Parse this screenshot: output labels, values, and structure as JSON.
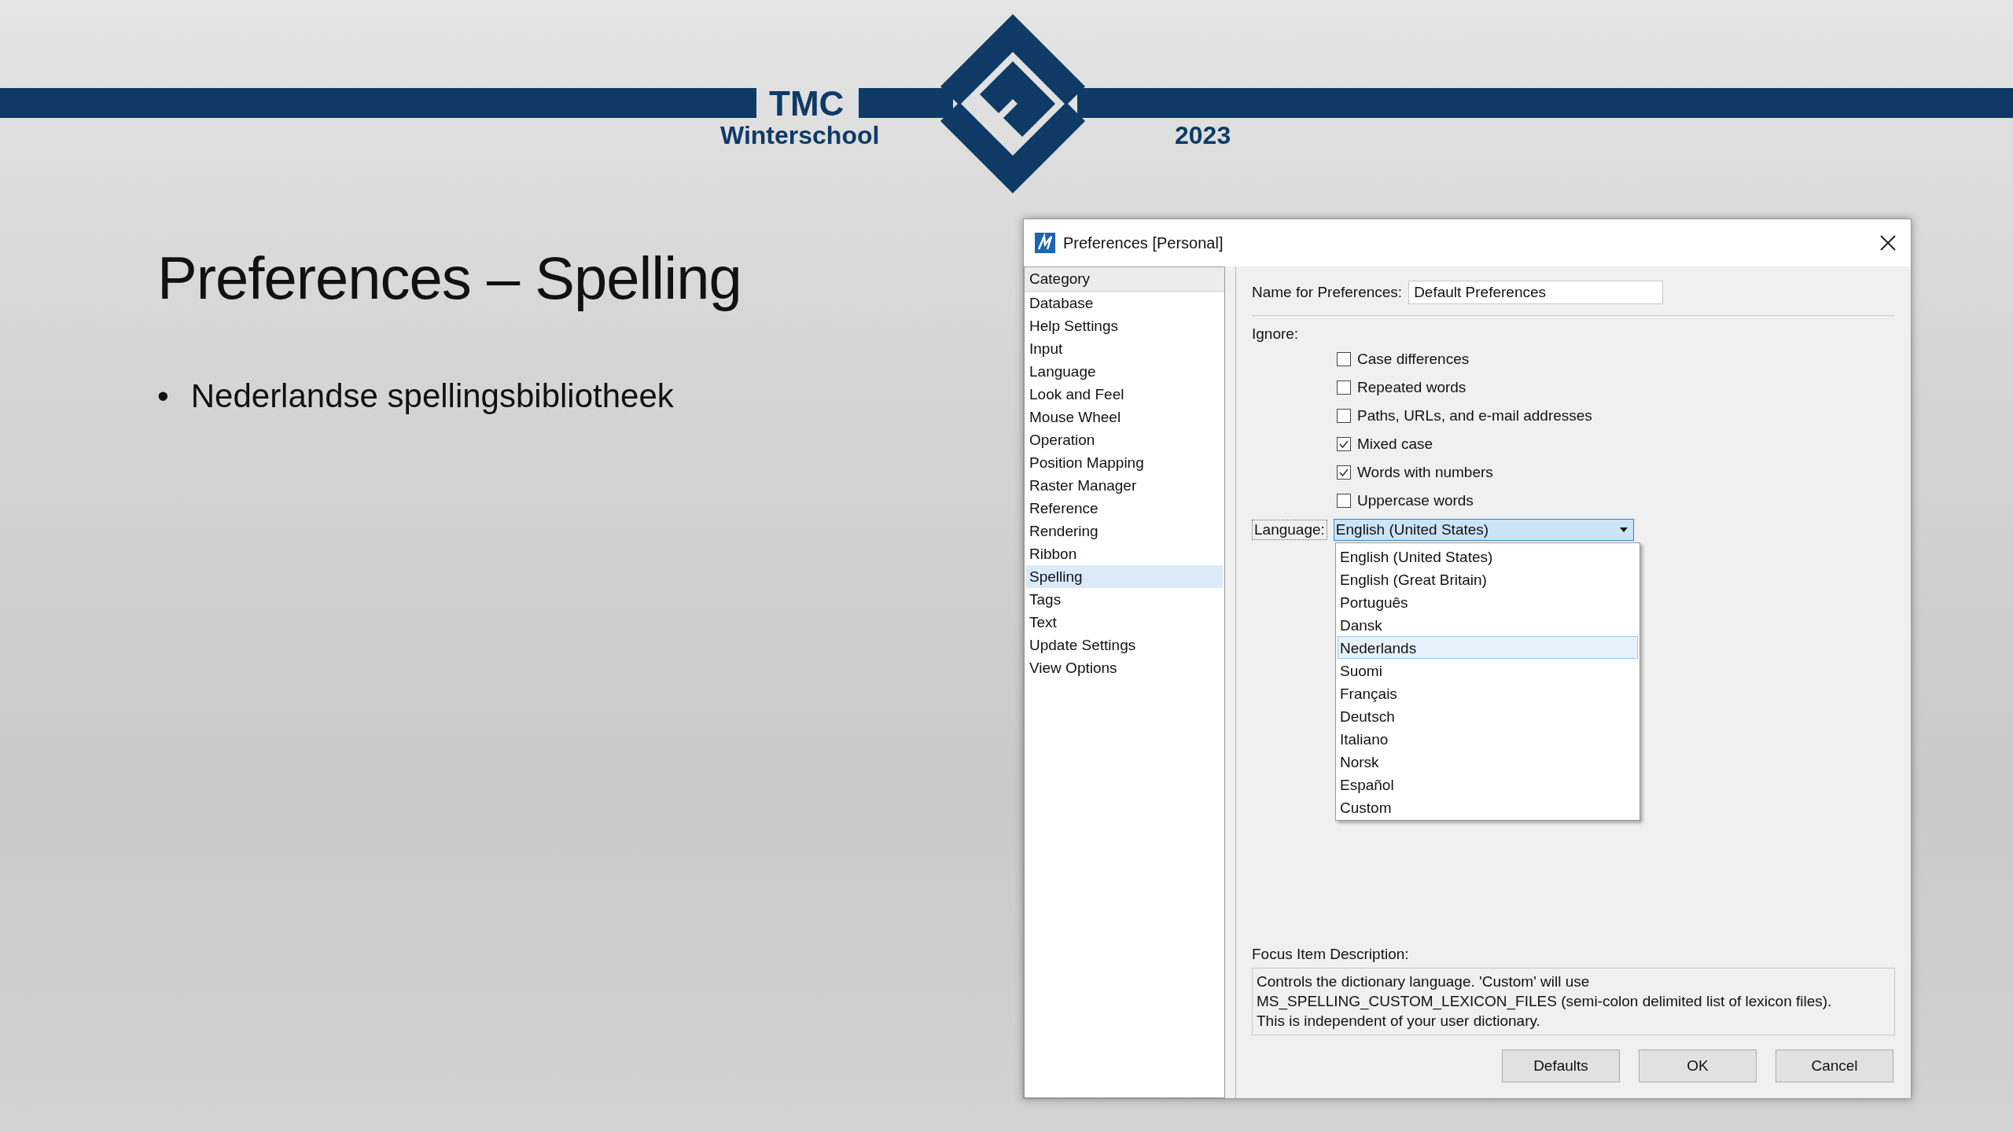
{
  "header": {
    "brand": "TMC",
    "subtitle": "Winterschool",
    "year": "2023"
  },
  "slide": {
    "title": "Preferences – Spelling",
    "bullets": [
      {
        "marker": "•",
        "text": "Nederlandse spellingsbibliotheek"
      }
    ]
  },
  "dialog": {
    "title": "Preferences [Personal]",
    "category_header": "Category",
    "categories": [
      {
        "label": "Database",
        "selected": false
      },
      {
        "label": "Help Settings",
        "selected": false
      },
      {
        "label": "Input",
        "selected": false
      },
      {
        "label": "Language",
        "selected": false
      },
      {
        "label": "Look and Feel",
        "selected": false
      },
      {
        "label": "Mouse Wheel",
        "selected": false
      },
      {
        "label": "Operation",
        "selected": false
      },
      {
        "label": "Position Mapping",
        "selected": false
      },
      {
        "label": "Raster Manager",
        "selected": false
      },
      {
        "label": "Reference",
        "selected": false
      },
      {
        "label": "Rendering",
        "selected": false
      },
      {
        "label": "Ribbon",
        "selected": false
      },
      {
        "label": "Spelling",
        "selected": true
      },
      {
        "label": "Tags",
        "selected": false
      },
      {
        "label": "Text",
        "selected": false
      },
      {
        "label": "Update Settings",
        "selected": false
      },
      {
        "label": "View Options",
        "selected": false
      }
    ],
    "name_label": "Name for Preferences:",
    "name_value": "Default Preferences",
    "ignore_label": "Ignore:",
    "options": [
      {
        "label": "Case differences",
        "checked": false
      },
      {
        "label": "Repeated words",
        "checked": false
      },
      {
        "label": "Paths, URLs, and e-mail addresses",
        "checked": false
      },
      {
        "label": "Mixed case",
        "checked": true
      },
      {
        "label": "Words with numbers",
        "checked": true
      },
      {
        "label": "Uppercase words",
        "checked": false
      }
    ],
    "language_label": "Language:",
    "language_value": "English (United States)",
    "language_expanded": true,
    "language_options": [
      {
        "label": "English (United States)",
        "selected": false
      },
      {
        "label": "English (Great Britain)",
        "selected": false
      },
      {
        "label": "Português",
        "selected": false
      },
      {
        "label": "Dansk",
        "selected": false
      },
      {
        "label": "Nederlands",
        "selected": true
      },
      {
        "label": "Suomi",
        "selected": false
      },
      {
        "label": "Français",
        "selected": false
      },
      {
        "label": "Deutsch",
        "selected": false
      },
      {
        "label": "Italiano",
        "selected": false
      },
      {
        "label": "Norsk",
        "selected": false
      },
      {
        "label": "Español",
        "selected": false
      },
      {
        "label": "Custom",
        "selected": false
      }
    ],
    "focus_label": "Focus Item Description:",
    "focus_text": "Controls the dictionary language. 'Custom' will use\nMS_SPELLING_CUSTOM_LEXICON_FILES (semi-colon delimited list of lexicon files).\nThis is independent of your user dictionary.",
    "buttons": [
      "Defaults",
      "OK",
      "Cancel"
    ]
  }
}
